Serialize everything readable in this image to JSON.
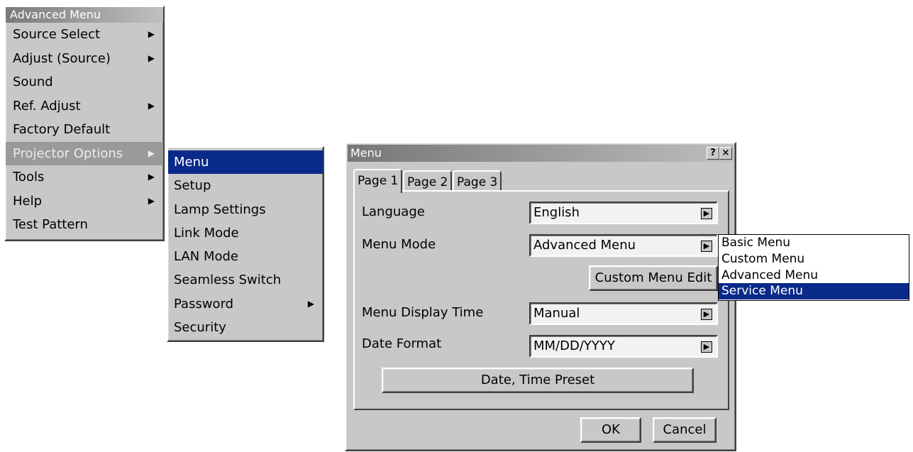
{
  "advanced_menu": {
    "title": "Advanced Menu",
    "items": [
      {
        "label": "Source Select",
        "arrow": "▶"
      },
      {
        "label": "Adjust (Source)",
        "arrow": "▶"
      },
      {
        "label": "Sound",
        "arrow": ""
      },
      {
        "label": "Ref. Adjust",
        "arrow": "▶"
      },
      {
        "label": "Factory Default",
        "arrow": ""
      },
      {
        "label": "Projector Options",
        "arrow": "▶"
      },
      {
        "label": "Tools",
        "arrow": "▶"
      },
      {
        "label": "Help",
        "arrow": "▶"
      },
      {
        "label": "Test Pattern",
        "arrow": ""
      }
    ]
  },
  "projector_options_menu": {
    "items": [
      {
        "label": "Menu",
        "arrow": ""
      },
      {
        "label": "Setup",
        "arrow": ""
      },
      {
        "label": "Lamp Settings",
        "arrow": ""
      },
      {
        "label": "Link Mode",
        "arrow": ""
      },
      {
        "label": "LAN Mode",
        "arrow": ""
      },
      {
        "label": "Seamless Switch",
        "arrow": ""
      },
      {
        "label": "Password",
        "arrow": "▶"
      },
      {
        "label": "Security",
        "arrow": ""
      }
    ]
  },
  "dialog": {
    "title": "Menu",
    "help_btn": "?",
    "close_btn": "×",
    "tabs": [
      "Page 1",
      "Page 2",
      "Page 3"
    ],
    "language_label": "Language",
    "language_value": "English",
    "menu_mode_label": "Menu Mode",
    "menu_mode_value": "Advanced Menu",
    "custom_menu_edit": "Custom Menu Edit",
    "menu_display_time_label": "Menu Display Time",
    "menu_display_time_value": "Manual",
    "date_format_label": "Date Format",
    "date_format_value": "MM/DD/YYYY",
    "date_time_preset": "Date, Time Preset",
    "ok": "OK",
    "cancel": "Cancel",
    "combo_arrow": "▶"
  },
  "menu_mode_dropdown": {
    "options": [
      "Basic Menu",
      "Custom Menu",
      "Advanced Menu",
      "Service Menu"
    ]
  }
}
